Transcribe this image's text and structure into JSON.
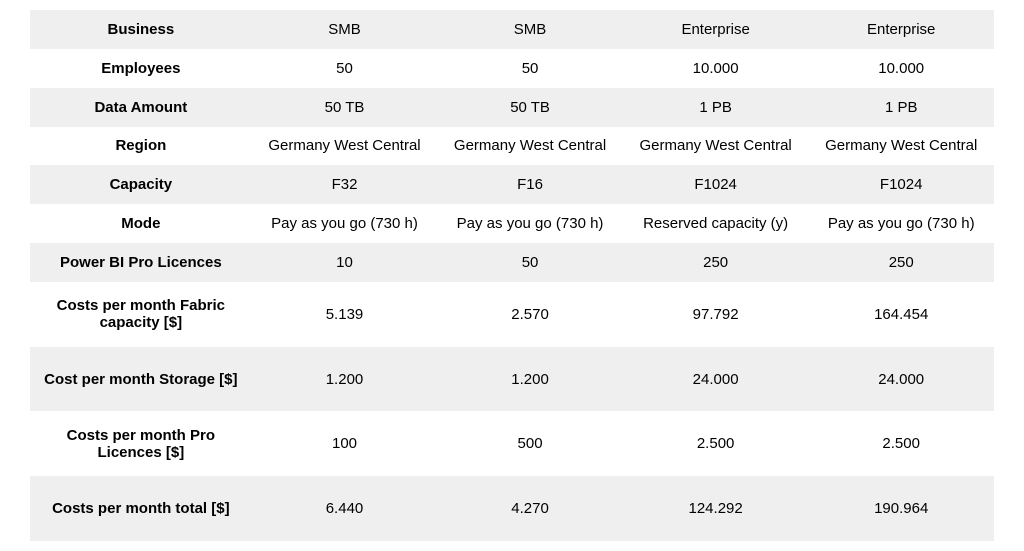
{
  "rows": [
    {
      "label": "Business",
      "v": [
        "SMB",
        "SMB",
        "Enterprise",
        "Enterprise"
      ],
      "stripe": true,
      "h": "short"
    },
    {
      "label": "Employees",
      "v": [
        "50",
        "50",
        "10.000",
        "10.000"
      ],
      "stripe": false,
      "h": "short"
    },
    {
      "label": "Data Amount",
      "v": [
        "50 TB",
        "50 TB",
        "1 PB",
        "1 PB"
      ],
      "stripe": true,
      "h": "short"
    },
    {
      "label": "Region",
      "v": [
        "Germany West Central",
        "Germany West Central",
        "Germany West Central",
        "Germany West Central"
      ],
      "stripe": false,
      "h": "short"
    },
    {
      "label": "Capacity",
      "v": [
        "F32",
        "F16",
        "F1024",
        "F1024"
      ],
      "stripe": true,
      "h": "short"
    },
    {
      "label": "Mode",
      "v": [
        "Pay as you go (730 h)",
        "Pay as you go (730 h)",
        "Reserved capacity (y)",
        "Pay as you go (730 h)"
      ],
      "stripe": false,
      "h": "short"
    },
    {
      "label": "Power BI Pro Licences",
      "v": [
        "10",
        "50",
        "250",
        "250"
      ],
      "stripe": true,
      "h": "short"
    },
    {
      "label": "Costs per month Fabric capacity [$]",
      "v": [
        "5.139",
        "2.570",
        "97.792",
        "164.454"
      ],
      "stripe": false,
      "h": "tall"
    },
    {
      "label": "Cost per month Storage [$]",
      "v": [
        "1.200",
        "1.200",
        "24.000",
        "24.000"
      ],
      "stripe": true,
      "h": "tall"
    },
    {
      "label": "Costs per month Pro Licences [$]",
      "v": [
        "100",
        "500",
        "2.500",
        "2.500"
      ],
      "stripe": false,
      "h": "tall"
    },
    {
      "label": "Costs per month total [$]",
      "v": [
        "6.440",
        "4.270",
        "124.292",
        "190.964"
      ],
      "stripe": true,
      "h": "tall"
    }
  ]
}
